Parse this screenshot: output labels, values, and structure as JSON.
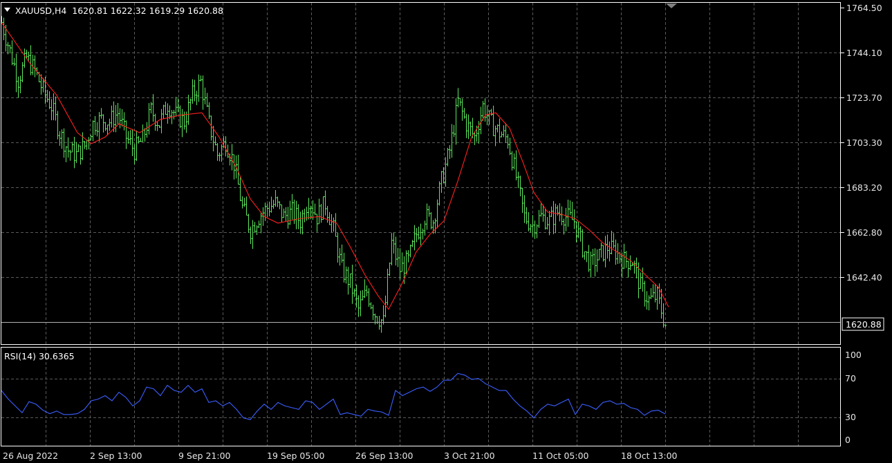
{
  "header": {
    "symbol_text": "XAUUSD,H4  1620.81 1622.32 1619.29 1620.88",
    "menu_icon": "triangle-down-icon"
  },
  "price_axis": {
    "labels": [
      "1764.50",
      "1744.10",
      "1723.70",
      "1703.30",
      "1683.20",
      "1662.80",
      "1642.40"
    ],
    "current_price": "1620.88"
  },
  "rsi": {
    "title_text": "RSI(14) 30.6365",
    "levels": [
      "100",
      "70",
      "30",
      "0"
    ]
  },
  "time_axis": {
    "labels": [
      "26 Aug 2022",
      "2 Sep 13:00",
      "9 Sep 21:00",
      "19 Sep 05:00",
      "26 Sep 13:00",
      "3 Oct 21:00",
      "11 Oct 05:00",
      "18 Oct 13:00"
    ]
  },
  "colors": {
    "background": "#000000",
    "grid": "#5a5a5a",
    "candles": "#5ee85e",
    "moving_average": "#ff2020",
    "rsi_line": "#3c5fff",
    "axis": "#ffffff",
    "text": "#ffffff"
  },
  "chart_data": [
    {
      "type": "candlestick",
      "title": "XAUUSD,H4",
      "ylim": [
        1610,
        1764.5
      ],
      "close_path": [
        [
          0,
          1758
        ],
        [
          12,
          1745
        ],
        [
          24,
          1732
        ],
        [
          36,
          1742
        ],
        [
          48,
          1736
        ],
        [
          60,
          1727
        ],
        [
          72,
          1720
        ],
        [
          84,
          1708
        ],
        [
          96,
          1700
        ],
        [
          108,
          1698
        ],
        [
          120,
          1702
        ],
        [
          132,
          1712
        ],
        [
          144,
          1714
        ],
        [
          156,
          1713
        ],
        [
          168,
          1717
        ],
        [
          180,
          1706
        ],
        [
          192,
          1700
        ],
        [
          204,
          1705
        ],
        [
          216,
          1718
        ],
        [
          228,
          1712
        ],
        [
          240,
          1721
        ],
        [
          252,
          1716
        ],
        [
          264,
          1713
        ],
        [
          276,
          1725
        ],
        [
          288,
          1731
        ],
        [
          300,
          1712
        ],
        [
          312,
          1698
        ],
        [
          324,
          1704
        ],
        [
          336,
          1694
        ],
        [
          348,
          1674
        ],
        [
          360,
          1664
        ],
        [
          372,
          1670
        ],
        [
          384,
          1674
        ],
        [
          396,
          1676
        ],
        [
          408,
          1670
        ],
        [
          420,
          1672
        ],
        [
          432,
          1668
        ],
        [
          444,
          1678
        ],
        [
          456,
          1670
        ],
        [
          468,
          1676
        ],
        [
          480,
          1664
        ],
        [
          492,
          1646
        ],
        [
          504,
          1640
        ],
        [
          516,
          1628
        ],
        [
          528,
          1636
        ],
        [
          540,
          1626
        ],
        [
          552,
          1622
        ],
        [
          564,
          1658
        ],
        [
          576,
          1646
        ],
        [
          588,
          1650
        ],
        [
          600,
          1662
        ],
        [
          612,
          1670
        ],
        [
          624,
          1668
        ],
        [
          636,
          1686
        ],
        [
          648,
          1700
        ],
        [
          660,
          1722
        ],
        [
          672,
          1712
        ],
        [
          684,
          1706
        ],
        [
          696,
          1720
        ],
        [
          708,
          1712
        ],
        [
          720,
          1708
        ],
        [
          732,
          1705
        ],
        [
          744,
          1688
        ],
        [
          756,
          1670
        ],
        [
          768,
          1666
        ],
        [
          780,
          1670
        ],
        [
          792,
          1668
        ],
        [
          804,
          1672
        ],
        [
          816,
          1670
        ],
        [
          828,
          1668
        ],
        [
          840,
          1656
        ],
        [
          852,
          1648
        ],
        [
          864,
          1652
        ],
        [
          876,
          1656
        ],
        [
          888,
          1654
        ],
        [
          900,
          1650
        ],
        [
          912,
          1650
        ],
        [
          924,
          1638
        ],
        [
          936,
          1632
        ],
        [
          948,
          1634
        ],
        [
          960,
          1620.88
        ]
      ],
      "moving_average_path": [
        [
          0,
          1758
        ],
        [
          40,
          1740
        ],
        [
          80,
          1725
        ],
        [
          110,
          1708
        ],
        [
          130,
          1703
        ],
        [
          150,
          1706
        ],
        [
          170,
          1712
        ],
        [
          200,
          1708
        ],
        [
          230,
          1714
        ],
        [
          260,
          1716
        ],
        [
          290,
          1717
        ],
        [
          315,
          1706
        ],
        [
          340,
          1692
        ],
        [
          360,
          1678
        ],
        [
          380,
          1670
        ],
        [
          400,
          1667
        ],
        [
          430,
          1669
        ],
        [
          460,
          1670
        ],
        [
          485,
          1667
        ],
        [
          505,
          1656
        ],
        [
          525,
          1644
        ],
        [
          545,
          1634
        ],
        [
          560,
          1628
        ],
        [
          580,
          1640
        ],
        [
          600,
          1654
        ],
        [
          620,
          1662
        ],
        [
          640,
          1668
        ],
        [
          660,
          1686
        ],
        [
          680,
          1706
        ],
        [
          700,
          1716
        ],
        [
          715,
          1717
        ],
        [
          735,
          1710
        ],
        [
          755,
          1694
        ],
        [
          770,
          1681
        ],
        [
          790,
          1672
        ],
        [
          810,
          1671
        ],
        [
          830,
          1669
        ],
        [
          850,
          1664
        ],
        [
          870,
          1658
        ],
        [
          890,
          1654
        ],
        [
          910,
          1650
        ],
        [
          930,
          1644
        ],
        [
          950,
          1638
        ],
        [
          965,
          1629
        ]
      ]
    },
    {
      "type": "line",
      "title": "RSI(14)",
      "ylim": [
        0,
        100
      ],
      "series": [
        {
          "name": "RSI(14)",
          "values": [
            [
              0,
              58
            ],
            [
              10,
              48
            ],
            [
              20,
              40
            ],
            [
              30,
              32
            ],
            [
              40,
              45
            ],
            [
              50,
              42
            ],
            [
              60,
              35
            ],
            [
              70,
              31
            ],
            [
              80,
              34
            ],
            [
              90,
              30
            ],
            [
              100,
              30
            ],
            [
              110,
              31
            ],
            [
              120,
              36
            ],
            [
              130,
              46
            ],
            [
              140,
              48
            ],
            [
              150,
              52
            ],
            [
              160,
              46
            ],
            [
              170,
              56
            ],
            [
              180,
              50
            ],
            [
              190,
              40
            ],
            [
              200,
              46
            ],
            [
              210,
              62
            ],
            [
              220,
              60
            ],
            [
              230,
              52
            ],
            [
              240,
              64
            ],
            [
              250,
              58
            ],
            [
              260,
              56
            ],
            [
              270,
              64
            ],
            [
              280,
              56
            ],
            [
              290,
              60
            ],
            [
              300,
              44
            ],
            [
              310,
              46
            ],
            [
              320,
              40
            ],
            [
              330,
              44
            ],
            [
              340,
              36
            ],
            [
              350,
              26
            ],
            [
              360,
              24
            ],
            [
              370,
              34
            ],
            [
              380,
              42
            ],
            [
              390,
              36
            ],
            [
              400,
              44
            ],
            [
              410,
              40
            ],
            [
              420,
              38
            ],
            [
              430,
              36
            ],
            [
              440,
              46
            ],
            [
              450,
              44
            ],
            [
              460,
              36
            ],
            [
              470,
              42
            ],
            [
              480,
              48
            ],
            [
              490,
              30
            ],
            [
              500,
              32
            ],
            [
              510,
              30
            ],
            [
              520,
              28
            ],
            [
              530,
              36
            ],
            [
              540,
              34
            ],
            [
              550,
              33
            ],
            [
              560,
              29
            ],
            [
              570,
              58
            ],
            [
              580,
              52
            ],
            [
              590,
              56
            ],
            [
              600,
              60
            ],
            [
              610,
              62
            ],
            [
              620,
              57
            ],
            [
              630,
              62
            ],
            [
              640,
              70
            ],
            [
              650,
              70
            ],
            [
              660,
              78
            ],
            [
              670,
              76
            ],
            [
              680,
              71
            ],
            [
              690,
              72
            ],
            [
              700,
              66
            ],
            [
              710,
              62
            ],
            [
              720,
              58
            ],
            [
              730,
              58
            ],
            [
              740,
              48
            ],
            [
              750,
              40
            ],
            [
              760,
              34
            ],
            [
              770,
              26
            ],
            [
              780,
              36
            ],
            [
              790,
              42
            ],
            [
              800,
              40
            ],
            [
              810,
              44
            ],
            [
              820,
              48
            ],
            [
              830,
              30
            ],
            [
              840,
              42
            ],
            [
              850,
              40
            ],
            [
              860,
              36
            ],
            [
              870,
              44
            ],
            [
              880,
              46
            ],
            [
              890,
              42
            ],
            [
              900,
              43
            ],
            [
              910,
              38
            ],
            [
              920,
              36
            ],
            [
              930,
              29
            ],
            [
              940,
              34
            ],
            [
              950,
              35
            ],
            [
              960,
              30.6365
            ]
          ]
        }
      ],
      "levels": [
        100,
        70,
        30,
        0
      ]
    }
  ]
}
